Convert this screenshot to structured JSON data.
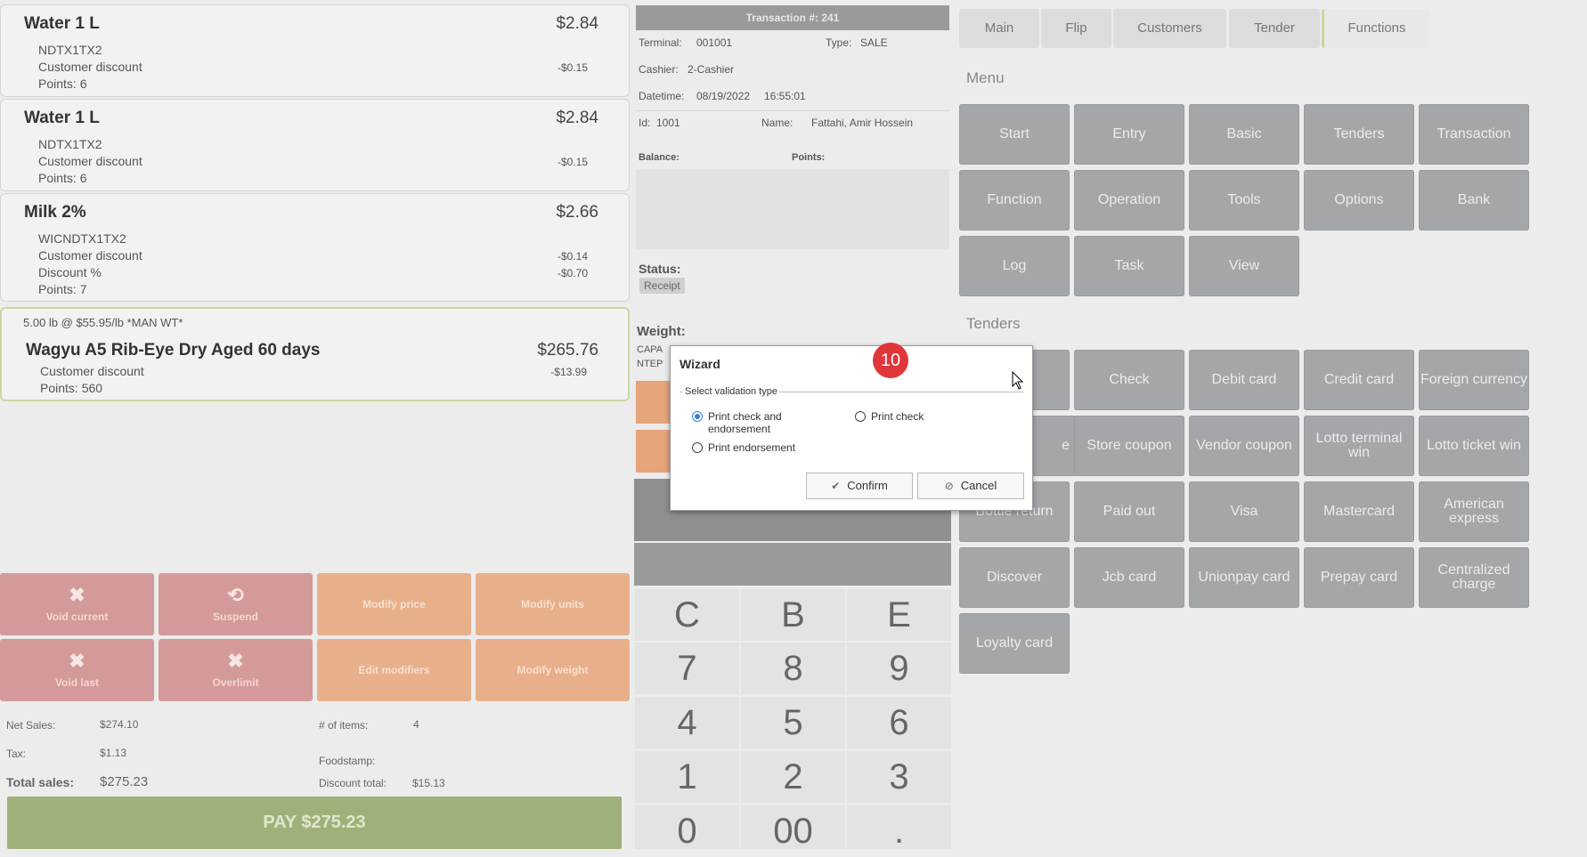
{
  "items": [
    {
      "name": "Water 1 L",
      "price": "$2.84",
      "code": "NDTX1TX2",
      "lines": [
        {
          "label": "Customer discount",
          "value": "-$0.15"
        },
        {
          "label": "Points: 6",
          "value": ""
        }
      ]
    },
    {
      "name": "Water 1 L",
      "price": "$2.84",
      "code": "NDTX1TX2",
      "lines": [
        {
          "label": "Customer discount",
          "value": "-$0.15"
        },
        {
          "label": "Points: 6",
          "value": ""
        }
      ]
    },
    {
      "name": "Milk 2%",
      "price": "$2.66",
      "code": "WICNDTX1TX2",
      "lines": [
        {
          "label": "Customer discount",
          "value": "-$0.14"
        },
        {
          "label": "Discount %",
          "value": "-$0.70"
        },
        {
          "label": "Points: 7",
          "value": ""
        }
      ]
    },
    {
      "prefix": "5.00 lb @ $55.95/lb *MAN WT*",
      "name": "Wagyu A5 Rib-Eye Dry Aged 60 days",
      "price": "$265.76",
      "lines": [
        {
          "label": "Customer discount",
          "value": "-$13.99"
        },
        {
          "label": "Points: 560",
          "value": ""
        }
      ]
    }
  ],
  "actions": {
    "void_current": "Void current",
    "suspend": "Suspend",
    "modify_price": "Modify price",
    "modify_units": "Modify units",
    "void_last": "Void last",
    "overlimit": "Overlimit",
    "edit_modifiers": "Edit modifiers",
    "modify_weight": "Modify weight"
  },
  "summary": {
    "net_sales_label": "Net Sales:",
    "net_sales": "$274.10",
    "tax_label": "Tax:",
    "tax": "$1.13",
    "total_label": "Total sales:",
    "total": "$275.23",
    "items_label": "# of items:",
    "items": "4",
    "foodstamp_label": "Foodstamp:",
    "discount_label": "Discount total:",
    "discount": "$15.13",
    "pay_label": "PAY $275.23"
  },
  "transaction": {
    "header": "Transaction #: 241",
    "terminal_label": "Terminal:",
    "terminal": "001001",
    "type_label": "Type:",
    "type": "SALE",
    "cashier_label": "Cashier:",
    "cashier": "2-Cashier",
    "datetime_label": "Datetime:",
    "date": "08/19/2022",
    "time": "16:55:01",
    "id_label": "Id:",
    "id": "1001",
    "name_label": "Name:",
    "name": "Fattahi, Amir Hossein",
    "balance_label": "Balance:",
    "points_label": "Points:",
    "status_label": "Status:",
    "status": "Receipt",
    "weight_label": "Weight:",
    "weight_line1": "CAPA",
    "weight_line2": "NTEP"
  },
  "keypad": [
    "C",
    "B",
    "E",
    "7",
    "8",
    "9",
    "4",
    "5",
    "6",
    "1",
    "2",
    "3",
    "0",
    "00",
    "."
  ],
  "tabs": [
    "Main",
    "Flip",
    "Customers",
    "Tender",
    "Functions"
  ],
  "menu_title": "Menu",
  "menu_tiles": [
    "Start",
    "Entry",
    "Basic",
    "Tenders",
    "Transaction",
    "Function",
    "Operation",
    "Tools",
    "Options",
    "Bank",
    "Log",
    "Task",
    "View"
  ],
  "tenders_title": "Tenders",
  "tender_tiles": [
    "",
    "Check",
    "Debit card",
    "Credit card",
    "Foreign currency",
    "e",
    "Store coupon",
    "Vendor coupon",
    "Lotto terminal win",
    "Lotto ticket win",
    "Bottle return",
    "Paid out",
    "Visa",
    "Mastercard",
    "American express",
    "Discover",
    "Jcb card",
    "Unionpay card",
    "Prepay card",
    "Centralized charge",
    "Loyalty card"
  ],
  "wizard": {
    "title": "Wizard",
    "group": "Select validation type",
    "opt1": "Print check and endorsement",
    "opt2": "Print check",
    "opt3": "Print endorsement",
    "confirm": "Confirm",
    "cancel": "Cancel",
    "step": "10"
  },
  "colors": {
    "accent": "#3a7bd5",
    "badge": "#e0363a"
  }
}
